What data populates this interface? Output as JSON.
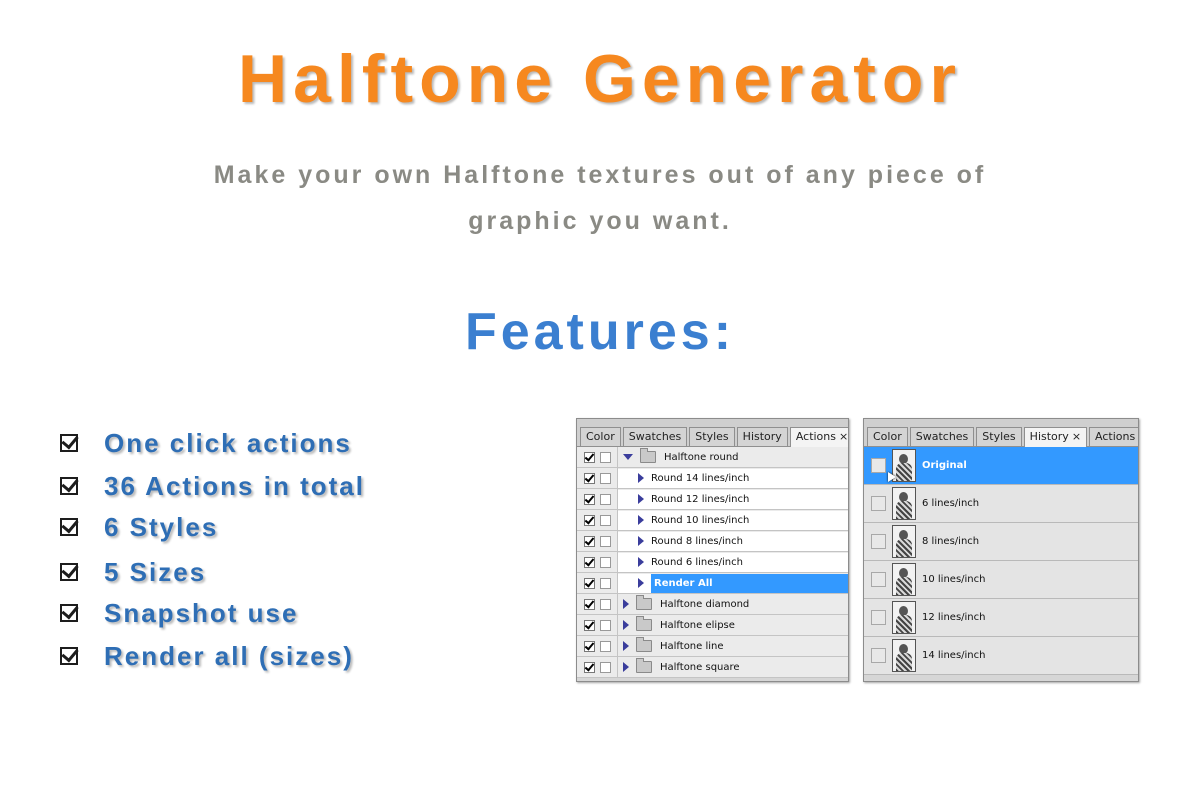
{
  "header": {
    "title": "Halftone Generator",
    "subtitle": "Make your own Halftone textures out of any piece of graphic you want.",
    "features_title": "Features:"
  },
  "features": [
    "One click actions",
    "36 Actions in total",
    "6 Styles",
    "5 Sizes",
    "Snapshot use",
    "Render all (sizes)"
  ],
  "actions_panel": {
    "tabs": [
      "Color",
      "Swatches",
      "Styles",
      "History",
      "Actions"
    ],
    "active_tab": "Actions",
    "close_glyph": "×",
    "rows": [
      {
        "label": "Halftone round",
        "type": "set",
        "expanded": true
      },
      {
        "label": "Round 14 lines/inch",
        "type": "action"
      },
      {
        "label": "Round 12 lines/inch",
        "type": "action"
      },
      {
        "label": "Round 10 lines/inch",
        "type": "action"
      },
      {
        "label": "Round 8 lines/inch",
        "type": "action"
      },
      {
        "label": "Round 6 lines/inch",
        "type": "action"
      },
      {
        "label": "Render All",
        "type": "action",
        "selected": true
      },
      {
        "label": "Halftone diamond",
        "type": "set"
      },
      {
        "label": "Halftone elipse",
        "type": "set"
      },
      {
        "label": "Halftone line",
        "type": "set"
      },
      {
        "label": "Halftone square",
        "type": "set"
      }
    ]
  },
  "history_panel": {
    "tabs": [
      "Color",
      "Swatches",
      "Styles",
      "History",
      "Actions"
    ],
    "active_tab": "History",
    "close_glyph": "×",
    "rows": [
      {
        "label": "Original",
        "selected": true
      },
      {
        "label": "6 lines/inch"
      },
      {
        "label": "8 lines/inch"
      },
      {
        "label": "10 lines/inch"
      },
      {
        "label": "12 lines/inch"
      },
      {
        "label": "14 lines/inch"
      }
    ]
  },
  "colors": {
    "title": "#f6881f",
    "subtitle": "#8a8a84",
    "features_title": "#3b7fd0",
    "feature_text": "#2e6eb5",
    "selection": "#3399ff"
  }
}
